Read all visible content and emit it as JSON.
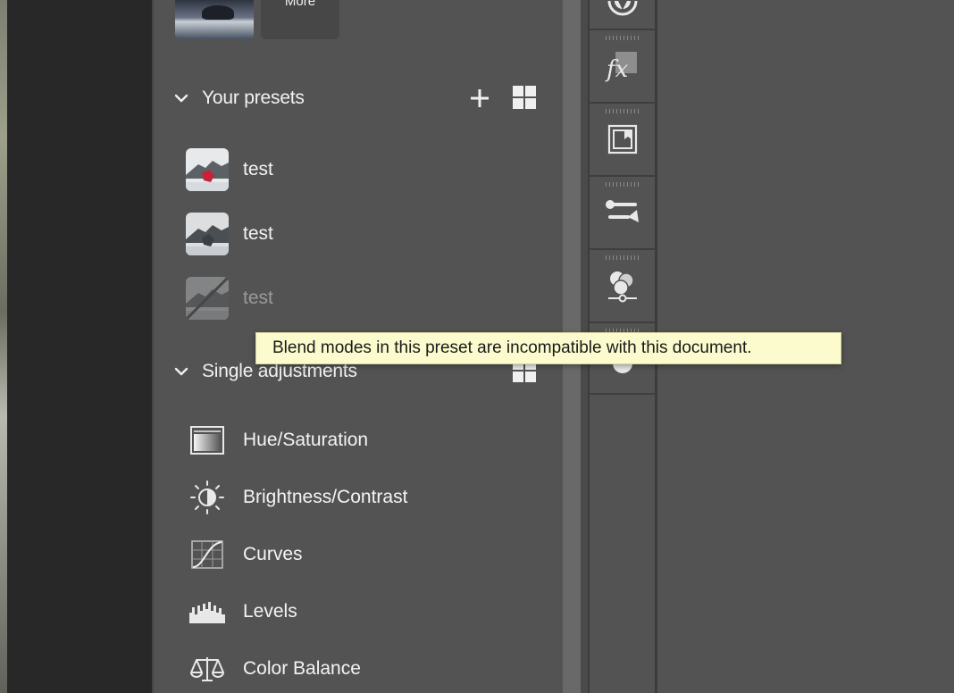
{
  "more_tile": {
    "label": "More"
  },
  "your_presets": {
    "title": "Your presets",
    "items": [
      {
        "label": "test",
        "disabled": false
      },
      {
        "label": "test",
        "disabled": false
      },
      {
        "label": "test",
        "disabled": true
      }
    ]
  },
  "tooltip": {
    "text": "Blend modes in this preset are incompatible with this document."
  },
  "single_adjustments": {
    "title": "Single adjustments",
    "items": [
      {
        "label": "Hue/Saturation",
        "icon": "hue-saturation-icon"
      },
      {
        "label": "Brightness/Contrast",
        "icon": "brightness-contrast-icon"
      },
      {
        "label": "Curves",
        "icon": "curves-icon"
      },
      {
        "label": "Levels",
        "icon": "levels-icon"
      },
      {
        "label": "Color Balance",
        "icon": "color-balance-icon"
      }
    ]
  },
  "toolstrip": {
    "tools": [
      "aperture-icon",
      "fx-styles-icon",
      "libraries-icon",
      "adjustments-icon",
      "channels-icon",
      "paths-icon"
    ]
  },
  "colors": {
    "panel_bg": "#535353",
    "tooltip_bg": "#fbfbcd",
    "text": "#f4f4f4",
    "disabled_text": "#9a9a9a"
  }
}
